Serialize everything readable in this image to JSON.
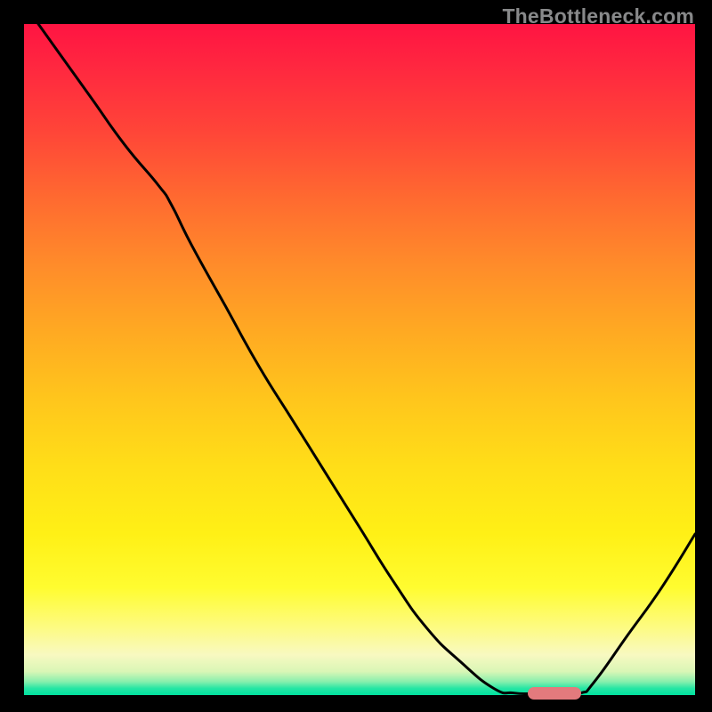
{
  "watermark": "TheBottleneck.com",
  "colors": {
    "gradient_top": "#ff1442",
    "gradient_bottom": "#00e19f",
    "curve": "#000000",
    "marker": "#e37a7d",
    "background": "#000000"
  },
  "chart_data": {
    "type": "line",
    "title": "",
    "xlabel": "",
    "ylabel": "",
    "xlim": [
      0,
      100
    ],
    "ylim": [
      0,
      100
    ],
    "series": [
      {
        "name": "bottleneck-curve",
        "x": [
          0,
          5,
          10,
          15,
          20,
          22,
          25,
          30,
          35,
          40,
          45,
          50,
          55,
          60,
          65,
          70,
          73,
          76,
          80,
          83,
          85,
          90,
          95,
          100
        ],
        "y": [
          103,
          96,
          89,
          82,
          76,
          73,
          67,
          58,
          49,
          41,
          33,
          25,
          17,
          10,
          5,
          1,
          0.3,
          0.2,
          0.2,
          0.3,
          2,
          9,
          16,
          24
        ]
      }
    ],
    "marker": {
      "x_start": 75,
      "x_end": 83,
      "y": 0.2
    },
    "grid": false,
    "legend": false
  }
}
